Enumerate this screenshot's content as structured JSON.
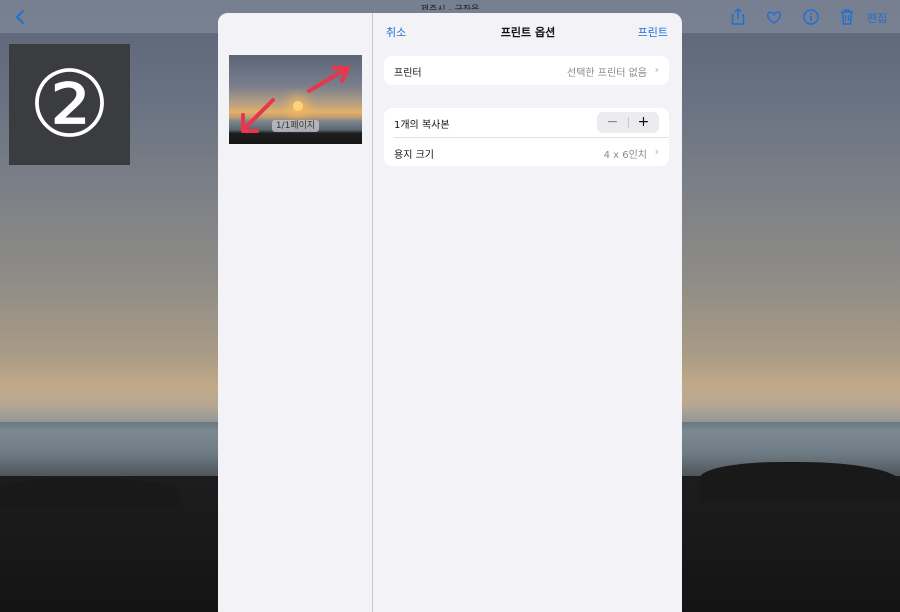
{
  "topbar": {
    "title": "제주시 - 구좌읍",
    "back_icon": "chevron-left-icon",
    "share_icon": "share-icon",
    "favorite_icon": "heart-icon",
    "info_icon": "info-icon",
    "delete_icon": "trash-icon",
    "edit_label": "편집"
  },
  "annotation": {
    "step": "②"
  },
  "sheet": {
    "cancel_label": "취소",
    "title": "프린트 옵션",
    "print_label": "프린트",
    "preview": {
      "page_label": "1/1페이지"
    },
    "printer": {
      "label": "프린터",
      "value": "선택한 프린터 없음"
    },
    "copies": {
      "label": "1개의 복사본",
      "minus": "−",
      "plus": "+"
    },
    "paper": {
      "label": "용지 크기",
      "value": "4 x 6인치"
    }
  },
  "colors": {
    "accent": "#1f6fd6",
    "annotation_arrow": "#e8364b"
  }
}
